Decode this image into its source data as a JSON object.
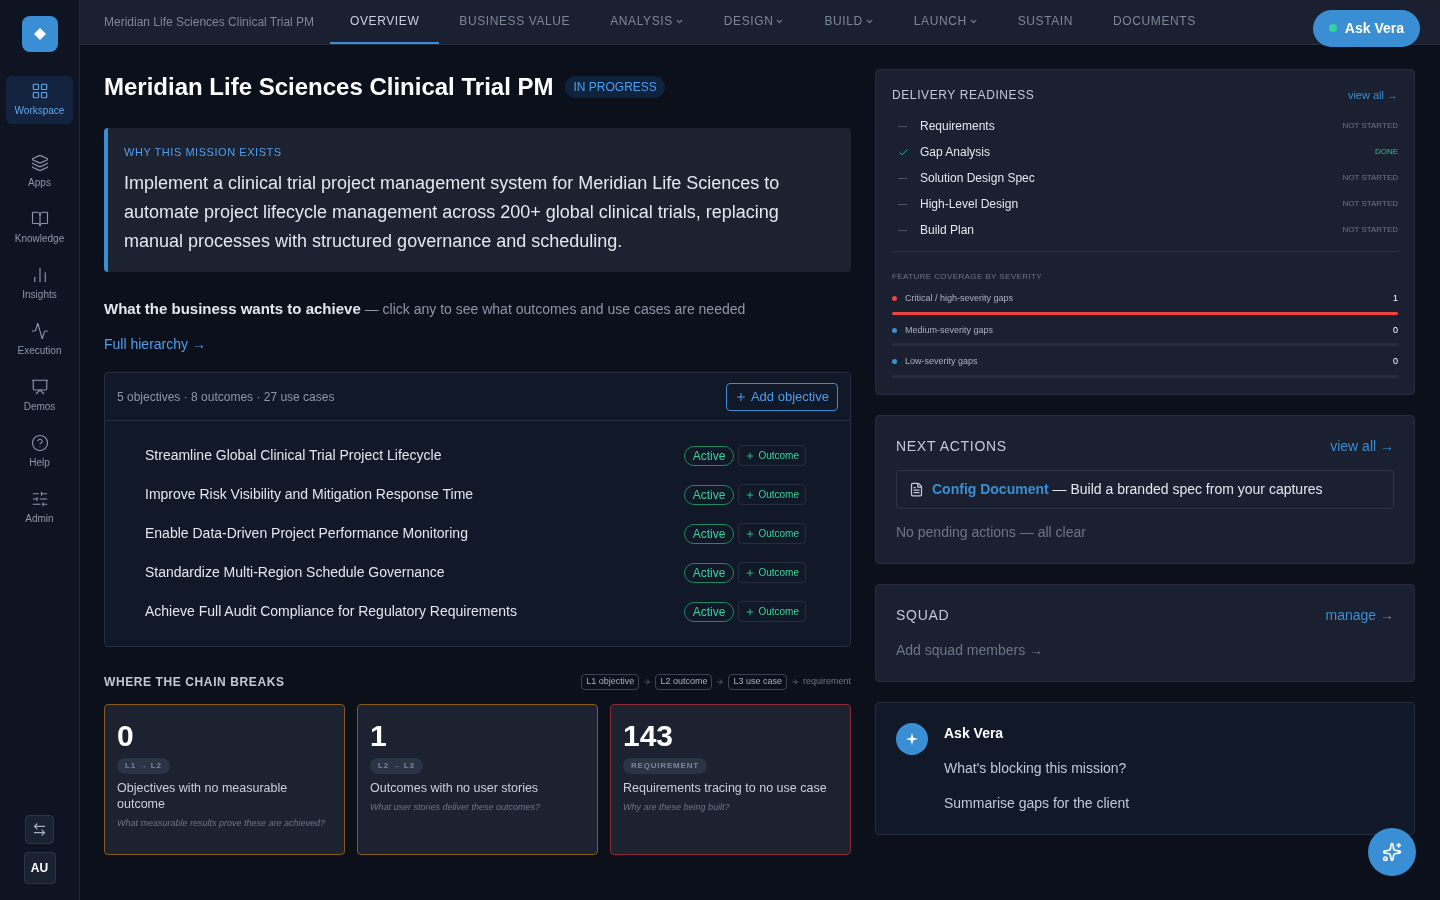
{
  "sidebar": {
    "items": [
      {
        "label": "Workspace",
        "selected": true
      },
      {
        "label": "Apps",
        "selected": false
      },
      {
        "label": "Knowledge",
        "selected": false
      },
      {
        "label": "Insights",
        "selected": false
      },
      {
        "label": "Execution",
        "selected": false
      },
      {
        "label": "Demos",
        "selected": false
      },
      {
        "label": "Help",
        "selected": false
      },
      {
        "label": "Admin",
        "selected": false
      }
    ],
    "avatar": "AU"
  },
  "topnav": {
    "project": "Meridian Life Sciences Clinical Trial PM",
    "tabs": [
      {
        "label": "OVERVIEW",
        "selected": true,
        "dropdown": false
      },
      {
        "label": "BUSINESS VALUE",
        "selected": false,
        "dropdown": false
      },
      {
        "label": "ANALYSIS",
        "selected": false,
        "dropdown": true
      },
      {
        "label": "DESIGN",
        "selected": false,
        "dropdown": true
      },
      {
        "label": "BUILD",
        "selected": false,
        "dropdown": true
      },
      {
        "label": "LAUNCH",
        "selected": false,
        "dropdown": true
      },
      {
        "label": "SUSTAIN",
        "selected": false,
        "dropdown": false
      },
      {
        "label": "DOCUMENTS",
        "selected": false,
        "dropdown": false
      }
    ],
    "ask_button": "Ask Vera"
  },
  "header": {
    "title": "Meridian Life Sciences Clinical Trial PM",
    "status": "IN PROGRESS"
  },
  "mission": {
    "label": "WHY THIS MISSION EXISTS",
    "text": "Implement a clinical trial project management system for Meridian Life Sciences to automate project lifecycle management across 200+ global clinical trials, replacing manual processes with structured governance and scheduling."
  },
  "goals": {
    "heading": "What the business wants to achieve",
    "hint": "— click any to see what outcomes and use cases are needed",
    "link": "Full hierarchy →"
  },
  "objectives": {
    "summary": "5 objectives · 8 outcomes · 27 use cases",
    "add_button": "Add objective",
    "items": [
      {
        "title": "Streamline Global Clinical Trial Project Lifecycle",
        "status": "Active",
        "button": "Outcome"
      },
      {
        "title": "Improve Risk Visibility and Mitigation Response Time",
        "status": "Active",
        "button": "Outcome"
      },
      {
        "title": "Enable Data-Driven Project Performance Monitoring",
        "status": "Active",
        "button": "Outcome"
      },
      {
        "title": "Standardize Multi-Region Schedule Governance",
        "status": "Active",
        "button": "Outcome"
      },
      {
        "title": "Achieve Full Audit Compliance for Regulatory Requirements",
        "status": "Active",
        "button": "Outcome"
      }
    ]
  },
  "chain": {
    "heading": "WHERE THE CHAIN BREAKS",
    "legend": [
      {
        "label": "L1 objective",
        "kind": "tag"
      },
      {
        "label": "L2 outcome",
        "kind": "tag"
      },
      {
        "label": "L3 use case",
        "kind": "tag"
      },
      {
        "label": "requirement",
        "kind": "plain"
      }
    ],
    "cards": [
      {
        "count": "0",
        "tag": "L1 → L2",
        "title": "Objectives with no measurable outcome",
        "question": "What measurable results prove these are achieved?",
        "color": "#8a5a1c"
      },
      {
        "count": "1",
        "tag": "L2 → L3",
        "title": "Outcomes with no user stories",
        "question": "What user stories deliver these outcomes?",
        "color": "#8a5a1c"
      },
      {
        "count": "143",
        "tag": "REQUIREMENT",
        "title": "Requirements tracing to no use case",
        "question": "Why are these being built?",
        "color": "#8b2a35"
      }
    ]
  },
  "delivery": {
    "title": "DELIVERY READINESS",
    "link": "view all →",
    "items": [
      {
        "label": "Requirements",
        "done": false,
        "status": "NOT STARTED"
      },
      {
        "label": "Gap Analysis",
        "done": true,
        "status": "DONE"
      },
      {
        "label": "Solution Design Spec",
        "done": false,
        "status": "NOT STARTED"
      },
      {
        "label": "High-Level Design",
        "done": false,
        "status": "NOT STARTED"
      },
      {
        "label": "Build Plan",
        "done": false,
        "status": "NOT STARTED"
      }
    ],
    "coverage_heading": "FEATURE COVERAGE BY SEVERITY",
    "coverage": [
      {
        "label": "Critical / high-severity gaps",
        "count": "1",
        "color": "#ef4444",
        "level": 1
      },
      {
        "label": "Medium-severity gaps",
        "count": "0",
        "color": "#3b8fd6",
        "level": 0
      },
      {
        "label": "Low-severity gaps",
        "count": "0",
        "color": "#3b8fd6",
        "level": 0
      }
    ]
  },
  "next_actions": {
    "title": "NEXT ACTIONS",
    "link": "view all →",
    "action": {
      "link": "Config Document",
      "text": "— Build a branded spec from your captures"
    },
    "empty": "No pending actions — all clear"
  },
  "squad": {
    "title": "SQUAD",
    "link": "manage →",
    "add": "Add squad members →"
  },
  "ask_vera": {
    "title": "Ask Vera",
    "prompts": [
      "What's blocking this mission?",
      "Summarise gaps for the client"
    ]
  }
}
